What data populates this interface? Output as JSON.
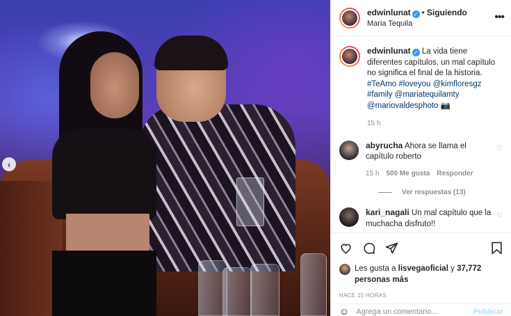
{
  "post": {
    "username": "edwinlunat",
    "follow_label": "Siguiendo",
    "location": "Maria Tequila",
    "more_icon": "more-options-icon",
    "caption": {
      "text": "La vida tiene diferentes capítulos, un mal capítulo no significa el final de la historia.",
      "hashtags": "#TeAmo #loveyou",
      "mentions": [
        "@kimfloresgz",
        "#family",
        "@mariatequilamty",
        "@mariovaldesphoto"
      ],
      "emoji": "📷",
      "time": "15 h"
    },
    "comments": [
      {
        "username": "abyrucha",
        "text": "Ahora se llama el capítulo roberto",
        "time": "15 h",
        "likes": "500 Me gusta",
        "reply_label": "Responder",
        "view_replies": "Ver respuestas (13)"
      },
      {
        "username": "kari_nagali",
        "text": "Un mal capítulo que la muchacha disfruto!!"
      }
    ],
    "likes": {
      "prefix": "Les gusta a",
      "user": "lisvegaoficial",
      "conj": "y",
      "count": "37,772 personas más"
    },
    "posted_ago": "HACE 15 HORAS",
    "add_comment": {
      "placeholder": "Agrega un comentario...",
      "publish": "Publicar"
    }
  },
  "icons": [
    "heart-icon",
    "comment-icon",
    "share-icon",
    "bookmark-icon",
    "verified-icon",
    "chevron-left-icon",
    "emoji-icon"
  ]
}
